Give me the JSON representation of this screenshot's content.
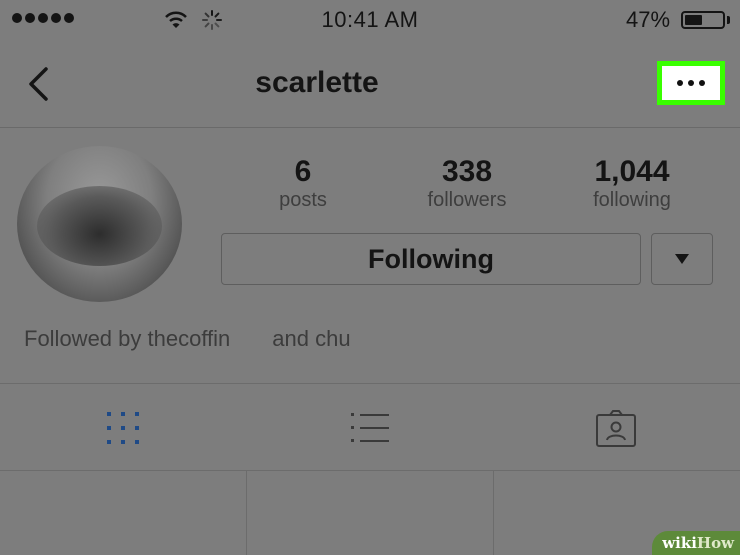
{
  "status_bar": {
    "time": "10:41 AM",
    "battery_percent": "47%",
    "battery_level": 0.47,
    "signal_dots": 5,
    "icons": [
      "signal-dots-icon",
      "wifi-icon",
      "loading-spinner-icon",
      "battery-icon"
    ]
  },
  "nav": {
    "title": "scarlette",
    "back_icon": "chevron-left-icon",
    "more_icon": "ellipsis-icon",
    "highlight_color": "#39ff00"
  },
  "profile": {
    "stats": [
      {
        "value": "6",
        "label": "posts"
      },
      {
        "value": "338",
        "label": "followers"
      },
      {
        "value": "1,044",
        "label": "following"
      }
    ],
    "following_button": "Following",
    "dropdown_icon": "caret-down-icon",
    "followed_by_prefix": "Followed by thecoffin",
    "followed_by_rest": "and chu"
  },
  "tabs": [
    {
      "name": "grid-view",
      "icon": "grid-icon",
      "active": true
    },
    {
      "name": "list-view",
      "icon": "list-icon",
      "active": false
    },
    {
      "name": "tagged",
      "icon": "tagged-photos-icon",
      "active": false
    }
  ],
  "colors": {
    "background": "#7d7d7d",
    "active_tab": "#1f4a86",
    "inactive_tab": "#3a3a3a",
    "text": "#141414"
  },
  "watermark": {
    "part1": "wiki",
    "part2": "How"
  }
}
